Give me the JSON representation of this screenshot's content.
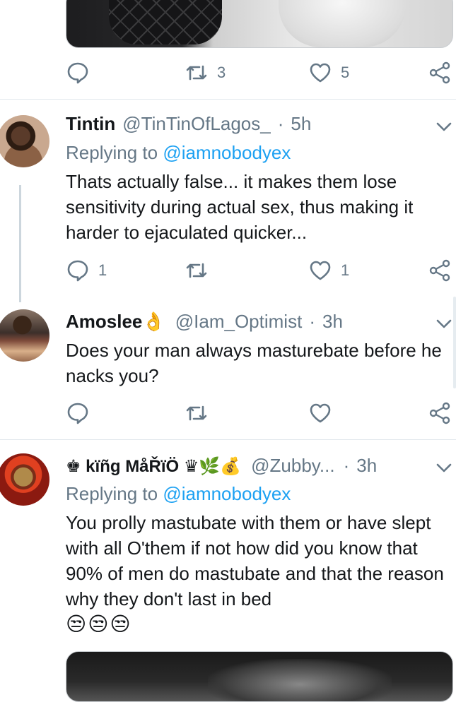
{
  "top_tweet": {
    "retweets": "3",
    "likes": "5"
  },
  "tweets": [
    {
      "name": "Tintin",
      "handle": "@TinTinOfLagos_",
      "dot": "·",
      "time": "5h",
      "replying_prefix": "Replying to",
      "replying_to": "@iamnobodyex",
      "text": "Thats actually false... it makes them lose sensitivity during actual sex, thus making it harder to ejaculated quicker...",
      "replies": "1",
      "retweets": "",
      "likes": "1"
    },
    {
      "name": "Amoslee",
      "name_emoji": "👌",
      "handle": "@Iam_Optimist",
      "dot": "·",
      "time": "3h",
      "text": "Does your man always masturebate before he nacks you?",
      "replies": "",
      "retweets": "",
      "likes": ""
    },
    {
      "name": "♚ kïñg MåŘïÖ ♛🌿💰",
      "handle": "@Zubby...",
      "dot": "·",
      "time": "3h",
      "replying_prefix": "Replying to",
      "replying_to": "@iamnobodyex",
      "text": "You prolly mastubate with them or have slept with all O'them if not how did you know that 90% of men do mastubate and that the reason why they don't last in bed",
      "text_emojis": "😒😒😒"
    }
  ],
  "colors": {
    "accent": "#1da1f2",
    "secondary": "#657786",
    "divider": "#e1e8ed"
  },
  "icons": [
    "reply-icon",
    "retweet-icon",
    "like-icon",
    "share-icon",
    "chevron-down-icon"
  ]
}
